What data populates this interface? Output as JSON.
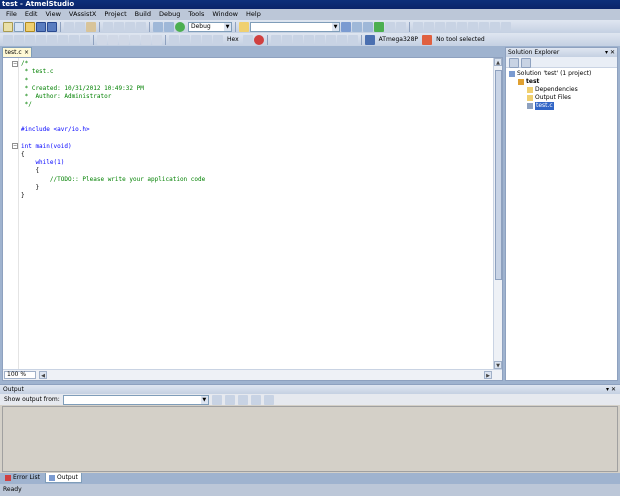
{
  "window": {
    "title": "test - AtmelStudio"
  },
  "menu": [
    "File",
    "Edit",
    "View",
    "VAssistX",
    "Project",
    "Build",
    "Debug",
    "Tools",
    "Window",
    "Help"
  ],
  "toolbar": {
    "config_combo": "Debug",
    "search_combo": "",
    "device_label": "ATmega328P",
    "tool_label": "No tool selected",
    "hex_label": "Hex"
  },
  "editor": {
    "tab_title": "test.c",
    "tab_close": "×",
    "zoom": "100 %",
    "lines": [
      {
        "cls": "c-cm",
        "text": "/*"
      },
      {
        "cls": "c-cm",
        "text": " * test.c"
      },
      {
        "cls": "c-cm",
        "text": " *"
      },
      {
        "cls": "c-cm",
        "text": " * Created: 10/31/2012 10:49:32 PM"
      },
      {
        "cls": "c-cm",
        "text": " *  Author: Administrator"
      },
      {
        "cls": "c-cm",
        "text": " */"
      },
      {
        "cls": "c-pl",
        "text": ""
      },
      {
        "cls": "c-pl",
        "text": ""
      },
      {
        "cls": "c-pp",
        "text": "#include <avr/io.h>"
      },
      {
        "cls": "c-pl",
        "text": ""
      },
      {
        "cls": "c-kw",
        "text": "int main(void)"
      },
      {
        "cls": "c-pl",
        "text": "{"
      },
      {
        "cls": "c-kw",
        "text": "    while(1)"
      },
      {
        "cls": "c-pl",
        "text": "    {"
      },
      {
        "cls": "c-cm",
        "text": "        //TODO:: Please write your application code"
      },
      {
        "cls": "c-pl",
        "text": "    }"
      },
      {
        "cls": "c-pl",
        "text": "}"
      }
    ]
  },
  "solution_explorer": {
    "title": "Solution Explorer",
    "controls": "▾ ✕",
    "items": [
      {
        "label": "Solution 'test' (1 project)",
        "indent": 0,
        "icon": "solution-icon"
      },
      {
        "label": "test",
        "indent": 1,
        "icon": "project-icon",
        "bold": true
      },
      {
        "label": "Dependencies",
        "indent": 2,
        "icon": "folder-icon"
      },
      {
        "label": "Output Files",
        "indent": 2,
        "icon": "folder-icon"
      },
      {
        "label": "test.c",
        "indent": 2,
        "icon": "c-file-icon",
        "selected": true
      }
    ]
  },
  "output": {
    "title": "Output",
    "controls": "▾ ✕",
    "show_from_label": "Show output from:",
    "show_from_value": ""
  },
  "bottom_tabs": [
    {
      "label": "Error List",
      "active": false
    },
    {
      "label": "Output",
      "active": true
    }
  ],
  "status": {
    "text": "Ready"
  },
  "colors": {
    "title_bar": "#0a246a",
    "comment": "#008000",
    "keyword": "#0000ff",
    "selection": "#3165c6"
  }
}
